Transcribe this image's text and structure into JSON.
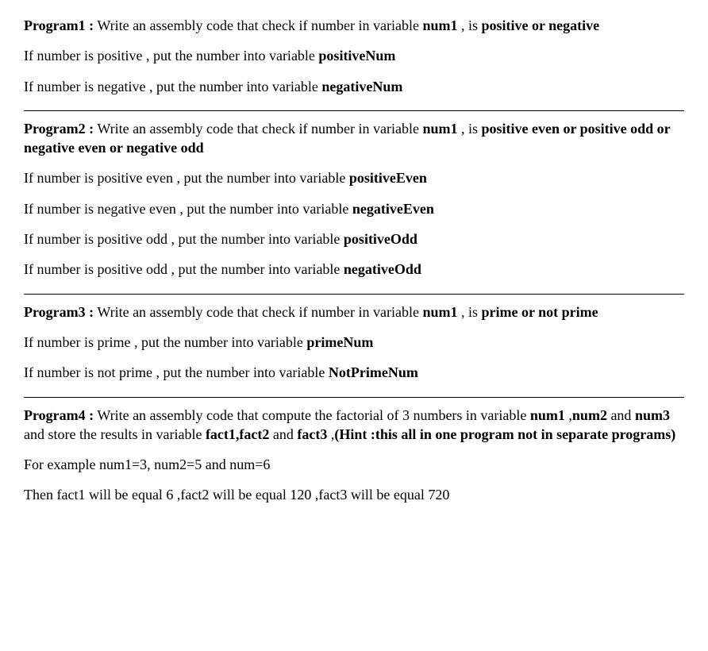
{
  "program1": {
    "title_label": "Program1 :",
    "title_pre": " Write an assembly code that check if number in variable ",
    "title_var": "num1",
    "title_mid": " , is ",
    "title_cond": "positive or negative",
    "line1_pre": "If number is positive , put the number into variable ",
    "line1_var": "positiveNum",
    "line2_pre": "If number is negative , put the number into variable ",
    "line2_var": "negativeNum"
  },
  "program2": {
    "title_label": "Program2 :",
    "title_pre": " Write an assembly code that check if number in variable ",
    "title_var": "num1",
    "title_mid": " , is ",
    "title_cond": "positive even or positive odd or negative even or negative odd",
    "line1_pre": "If number is positive even  , put the number into variable ",
    "line1_var": "positiveEven",
    "line2_pre": "If number is negative even , put the number into variable ",
    "line2_var": "negativeEven",
    "line3_pre": "If number is positive odd  , put the number into variable ",
    "line3_var": "positiveOdd",
    "line4_pre": "If number is positive odd  , put the number into variable ",
    "line4_var": "negativeOdd"
  },
  "program3": {
    "title_label": " Program3 :",
    "title_pre": " Write an assembly code that check if number in variable ",
    "title_var": "num1",
    "title_mid": " , is ",
    "title_cond": "prime or  not prime",
    "line1_pre": "If number is prime , put the number into variable ",
    "line1_var": "primeNum",
    "line2_pre": "If number is not prime , put the number into variable ",
    "line2_var": "NotPrimeNum"
  },
  "program4": {
    "title_label": "Program4 :",
    "title_pre": " Write an assembly code that compute the factorial of 3 numbers in variable ",
    "title_var1": "num1",
    "title_mid1": " ,",
    "title_var2": "num2",
    "title_mid2": " and ",
    "title_var3": "num3",
    "title_mid3": " and store the results in variable ",
    "title_var4": "fact1,fact2",
    "title_mid4": " and ",
    "title_var5": "fact3",
    "title_mid5": " ,",
    "title_hint": "(Hint :this all in one program not in separate programs)",
    "line1": "For example num1=3, num2=5 and num=6",
    "line2": "Then fact1 will be equal  6 ,fact2 will be equal 120  ,fact3 will be equal  720"
  }
}
